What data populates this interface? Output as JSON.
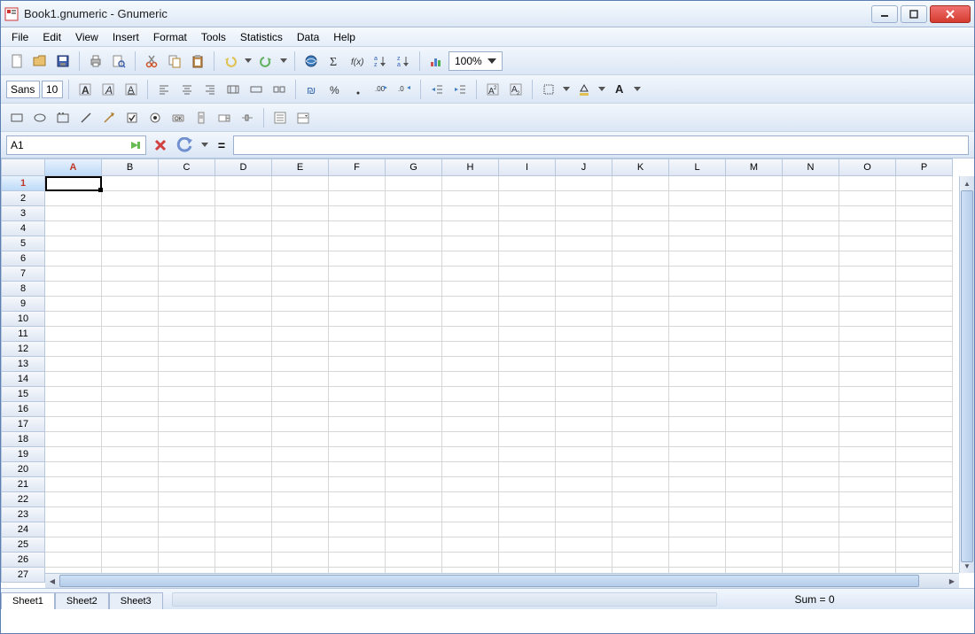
{
  "window": {
    "title": "Book1.gnumeric - Gnumeric"
  },
  "menu": [
    "File",
    "Edit",
    "View",
    "Insert",
    "Format",
    "Tools",
    "Statistics",
    "Data",
    "Help"
  ],
  "toolbar2": {
    "font_name": "Sans",
    "font_size": "10"
  },
  "zoom": "100%",
  "formula": {
    "cell_ref": "A1",
    "eq": "=",
    "value": ""
  },
  "columns": [
    "A",
    "B",
    "C",
    "D",
    "E",
    "F",
    "G",
    "H",
    "I",
    "J",
    "K",
    "L",
    "M",
    "N",
    "O",
    "P"
  ],
  "rows": [
    "1",
    "2",
    "3",
    "4",
    "5",
    "6",
    "7",
    "8",
    "9",
    "10",
    "11",
    "12",
    "13",
    "14",
    "15",
    "16",
    "17",
    "18",
    "19",
    "20",
    "21",
    "22",
    "23",
    "24",
    "25",
    "26",
    "27"
  ],
  "active": {
    "col": "A",
    "row": "1"
  },
  "sheets": [
    "Sheet1",
    "Sheet2",
    "Sheet3"
  ],
  "active_sheet": "Sheet1",
  "status": {
    "sum": "Sum = 0"
  }
}
